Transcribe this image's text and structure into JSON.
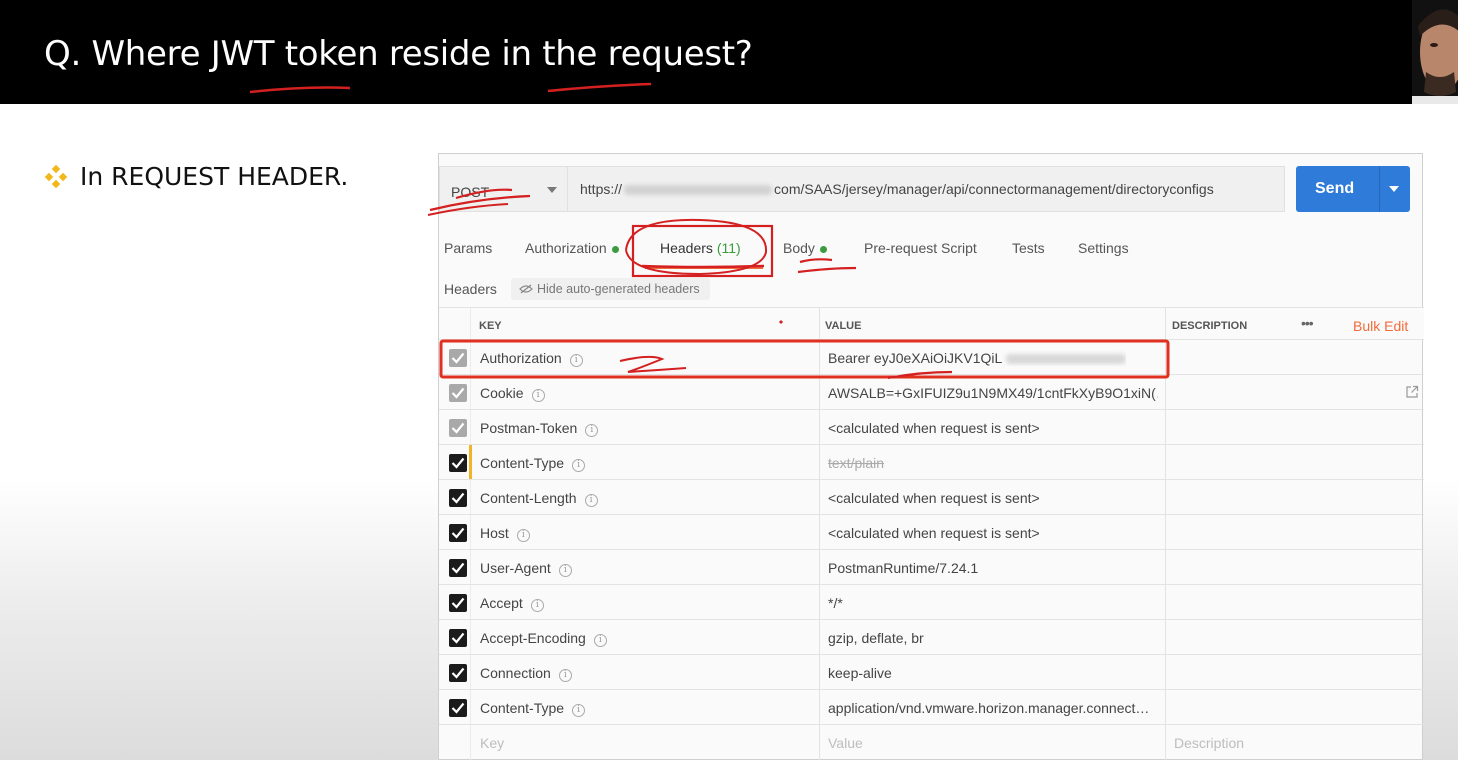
{
  "slide": {
    "title": "Q. Where JWT token reside in the request?",
    "bullet": "In REQUEST HEADER."
  },
  "request": {
    "method": "POST",
    "url_prefix": "https://",
    "url_suffix": "com/SAAS/jersey/manager/api/connectormanagement/directoryconfigs",
    "send_label": "Send"
  },
  "tabs": [
    {
      "label": "Params"
    },
    {
      "label": "Authorization"
    },
    {
      "label": "Headers",
      "count": "(11)"
    },
    {
      "label": "Body"
    },
    {
      "label": "Pre-request Script"
    },
    {
      "label": "Tests"
    },
    {
      "label": "Settings"
    }
  ],
  "headers_panel": {
    "label": "Headers",
    "hide_auto": "Hide auto-generated headers",
    "columns": {
      "key": "KEY",
      "value": "VALUE",
      "description": "DESCRIPTION"
    },
    "more": "•••",
    "bulk_edit": "Bulk Edit",
    "rows": [
      {
        "key": "Authorization",
        "value": "Bearer eyJ0eXAiOiJKV1QiL"
      },
      {
        "key": "Cookie",
        "value": "AWSALB=+GxIFUIZ9u1N9MX49/1cntFkXyB9O1xiN(…"
      },
      {
        "key": "Postman-Token",
        "value": "<calculated when request is sent>"
      },
      {
        "key": "Content-Type",
        "value": "text/plain"
      },
      {
        "key": "Content-Length",
        "value": "<calculated when request is sent>"
      },
      {
        "key": "Host",
        "value": "<calculated when request is sent>"
      },
      {
        "key": "User-Agent",
        "value": "PostmanRuntime/7.24.1"
      },
      {
        "key": "Accept",
        "value": "*/*"
      },
      {
        "key": "Accept-Encoding",
        "value": "gzip, deflate, br"
      },
      {
        "key": "Connection",
        "value": "keep-alive"
      },
      {
        "key": "Content-Type",
        "value": "application/vnd.vmware.horizon.manager.connect…"
      }
    ],
    "placeholder": {
      "key": "Key",
      "value": "Value",
      "description": "Description"
    }
  },
  "colors": {
    "send": "#2f7bd9",
    "accent": "#f26b3a",
    "annotation": "#d42020"
  },
  "icons": [
    "bullet-diamond-icon",
    "dropdown-caret-icon",
    "info-icon",
    "eye-slash-icon",
    "external-link-icon",
    "checkbox-icon"
  ]
}
